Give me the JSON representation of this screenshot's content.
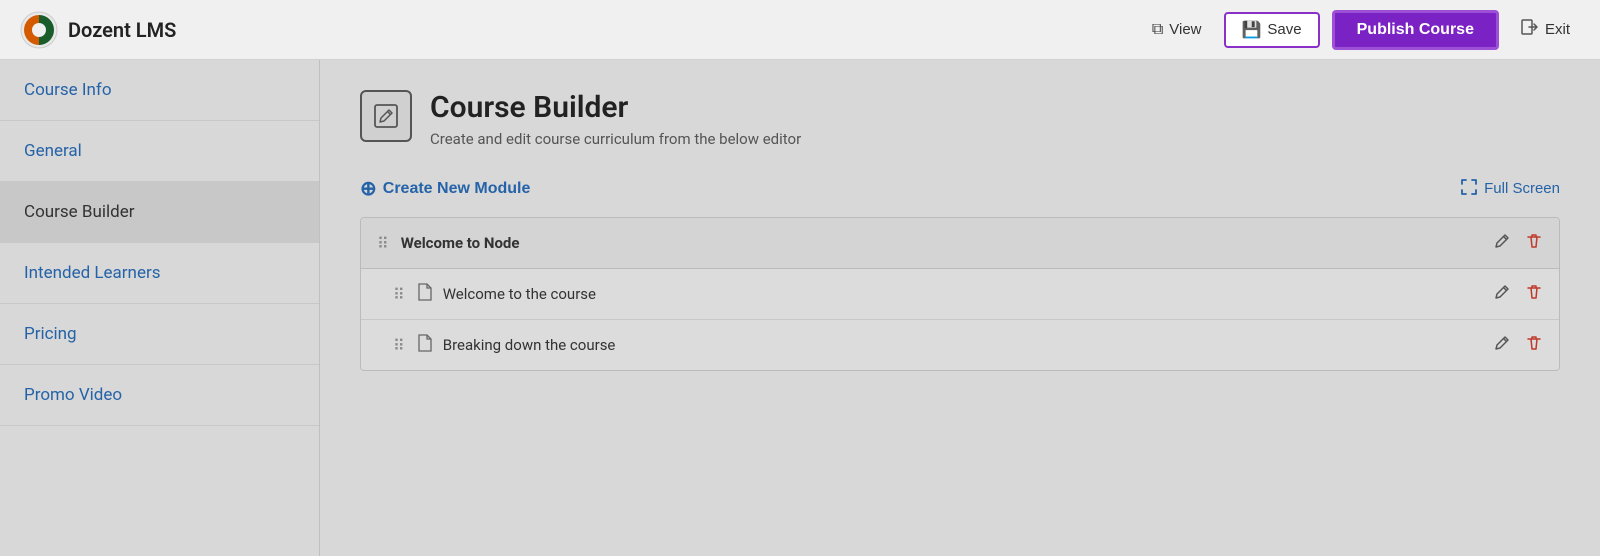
{
  "header": {
    "logo_text": "Dozent LMS",
    "view_label": "View",
    "save_label": "Save",
    "publish_label": "Publish Course",
    "exit_label": "Exit"
  },
  "sidebar": {
    "items": [
      {
        "id": "course-info",
        "label": "Course Info",
        "active": false
      },
      {
        "id": "general",
        "label": "General",
        "active": false
      },
      {
        "id": "course-builder",
        "label": "Course Builder",
        "active": true
      },
      {
        "id": "intended-learners",
        "label": "Intended Learners",
        "active": false
      },
      {
        "id": "pricing",
        "label": "Pricing",
        "active": false
      },
      {
        "id": "promo-video",
        "label": "Promo Video",
        "active": false
      }
    ]
  },
  "main": {
    "section_title": "Course Builder",
    "section_subtitle": "Create and edit course curriculum from the below editor",
    "create_module_label": "Create New Module",
    "fullscreen_label": "Full Screen",
    "modules": [
      {
        "id": "module-1",
        "title": "Welcome to Node",
        "lessons": [
          {
            "id": "lesson-1",
            "title": "Welcome to the course"
          },
          {
            "id": "lesson-2",
            "title": "Breaking down the course"
          }
        ]
      }
    ]
  },
  "icons": {
    "drag": "⠿",
    "file": "🗋",
    "edit": "✎",
    "delete": "🗑",
    "plus_circle": "⊕",
    "fullscreen": "⛶",
    "view": "⧉",
    "save_disk": "💾",
    "exit": "⎋"
  },
  "colors": {
    "accent": "#7b22c4",
    "link": "#2563a8",
    "delete_red": "#c0392b"
  }
}
